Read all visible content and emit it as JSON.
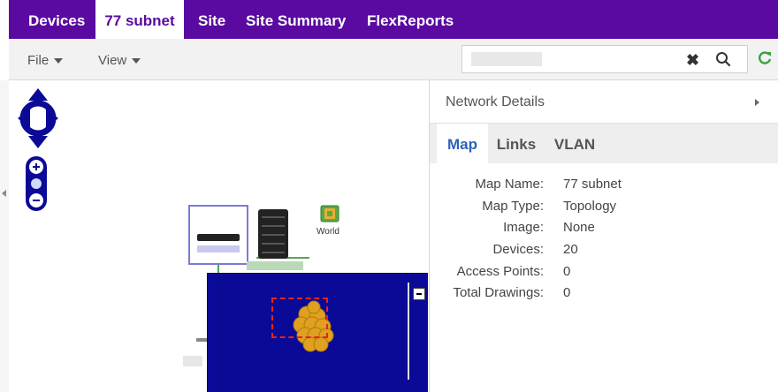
{
  "tabs": [
    {
      "label": "Devices"
    },
    {
      "label": "77 subnet"
    },
    {
      "label": "Site"
    },
    {
      "label": "Site Summary"
    },
    {
      "label": "FlexReports"
    }
  ],
  "active_tab": "77 subnet",
  "toolbar": {
    "file_label": "File",
    "view_label": "View"
  },
  "search": {
    "value": "",
    "clear_icon": "close-icon",
    "search_icon": "search-icon",
    "refresh_icon": "refresh-icon"
  },
  "map": {
    "world_label": "World"
  },
  "details": {
    "title": "Network Details",
    "tabs": [
      {
        "label": "Map"
      },
      {
        "label": "Links"
      },
      {
        "label": "VLAN"
      }
    ],
    "active_tab": "Map",
    "properties": [
      {
        "label": "Map Name:",
        "value": "77 subnet"
      },
      {
        "label": "Map Type:",
        "value": "Topology"
      },
      {
        "label": "Image:",
        "value": "None"
      },
      {
        "label": "Devices:",
        "value": "20"
      },
      {
        "label": "Access Points:",
        "value": "0"
      },
      {
        "label": "Total Drawings:",
        "value": "0"
      }
    ]
  },
  "colors": {
    "tabbar": "#5a0aa0",
    "active_tab_text": "#5a0aa0",
    "overview_bg": "#0a0a96",
    "viewport_border": "#e0261f",
    "detail_tab_active": "#2a63b8",
    "refresh_green": "#3aa040"
  }
}
